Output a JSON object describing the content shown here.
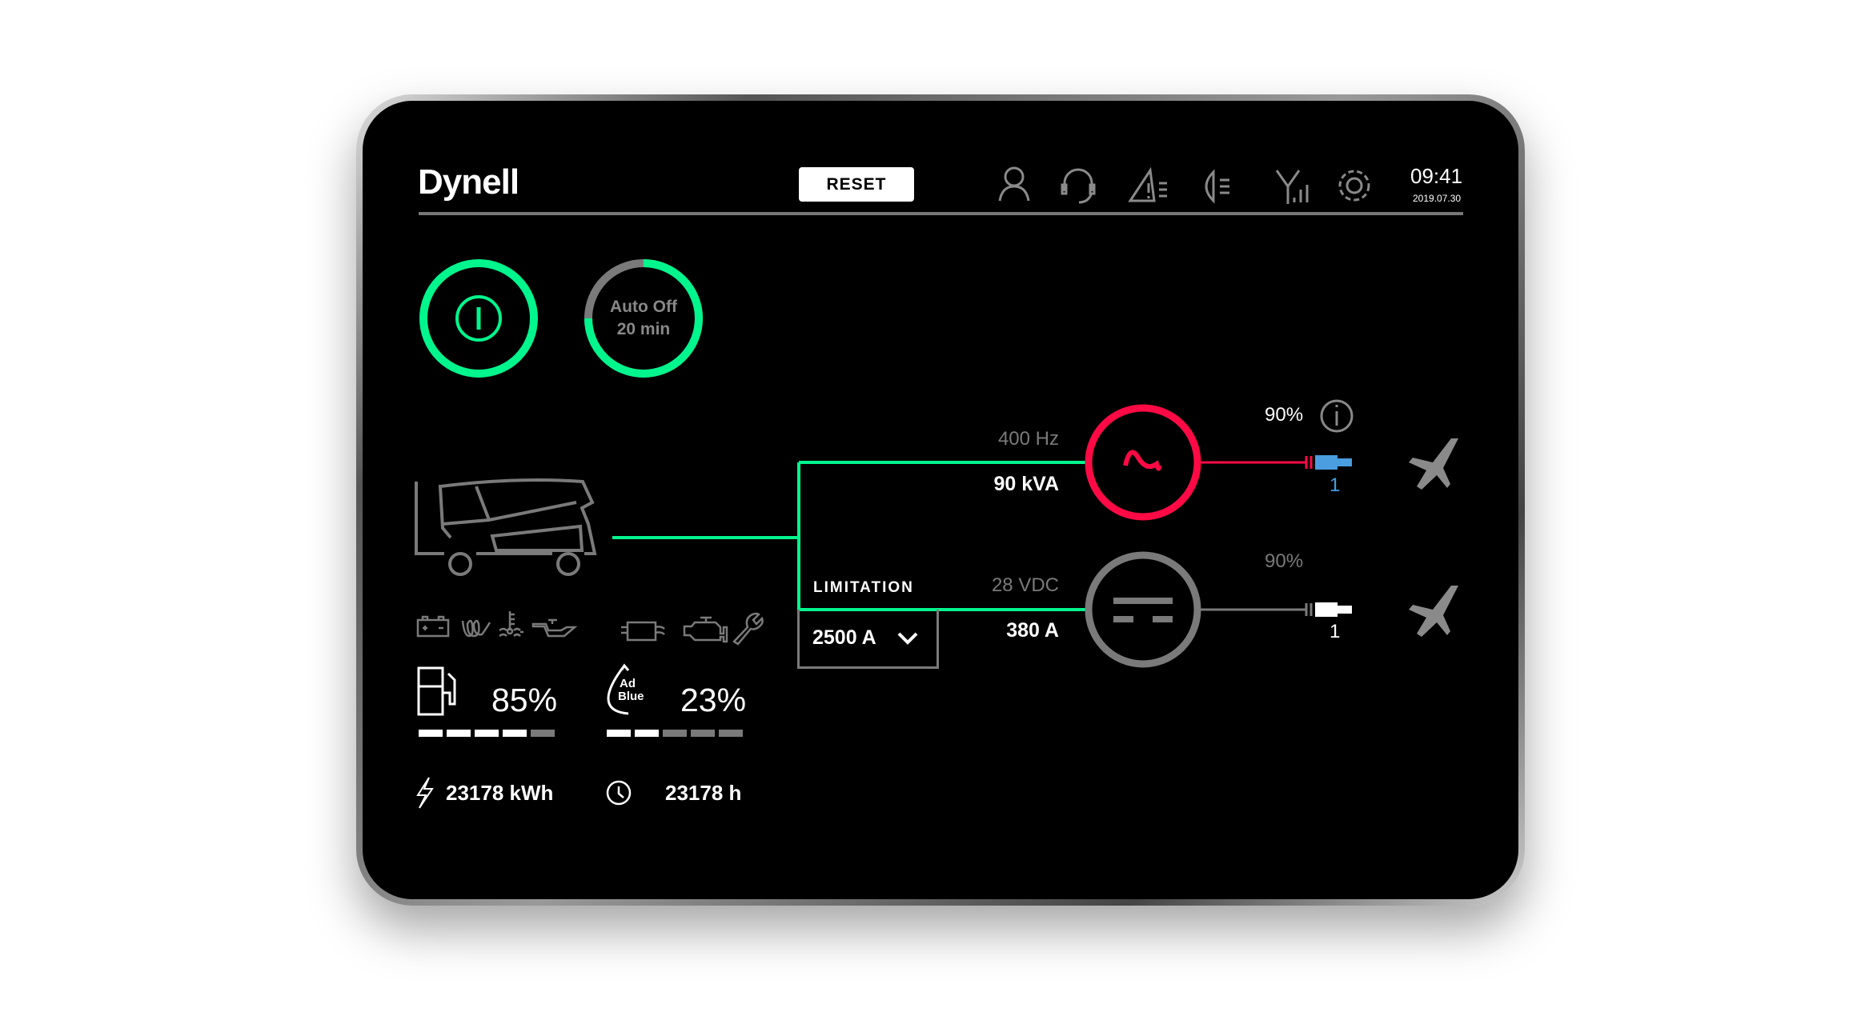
{
  "header": {
    "logo": "Dynell",
    "reset_label": "RESET",
    "time": "09:41",
    "date": "2019.07.30",
    "icons": [
      "user-icon",
      "headset-icon",
      "warning-list-icon",
      "headlight-icon",
      "signal-icon",
      "gear-icon"
    ]
  },
  "controls": {
    "power_icon": "power-icon",
    "auto_off_line1": "Auto Off",
    "auto_off_line2": "20 min",
    "auto_off_remaining_fraction": 0.75
  },
  "colors": {
    "accent": "#00f58c",
    "ac_red": "#ff0a45",
    "connector_blue": "#4a9ddf",
    "inactive": "#7a7a7a"
  },
  "ac": {
    "frequency": "400 Hz",
    "power": "90 kVA",
    "percent": "90%",
    "connector_number": "1",
    "active": true
  },
  "dc": {
    "voltage": "28 VDC",
    "current": "380 A",
    "percent": "90%",
    "connector_number": "1",
    "active": false
  },
  "limitation": {
    "label": "LIMITATION",
    "value": "2500 A"
  },
  "status_icons": [
    "battery-icon",
    "glow-plug-icon",
    "coolant-temperature-icon",
    "oil-pressure-icon",
    "particulate-filter-icon",
    "engine-icon",
    "wrench-icon"
  ],
  "fuel": {
    "percent_label": "85%",
    "level_segments": 4,
    "total_segments": 5
  },
  "adblue": {
    "icon_text_1": "Ad",
    "icon_text_2": "Blue",
    "percent_label": "23%",
    "level_segments": 2,
    "total_segments": 5
  },
  "energy": {
    "value": "23178 kWh"
  },
  "hours": {
    "value": "23178 h"
  }
}
